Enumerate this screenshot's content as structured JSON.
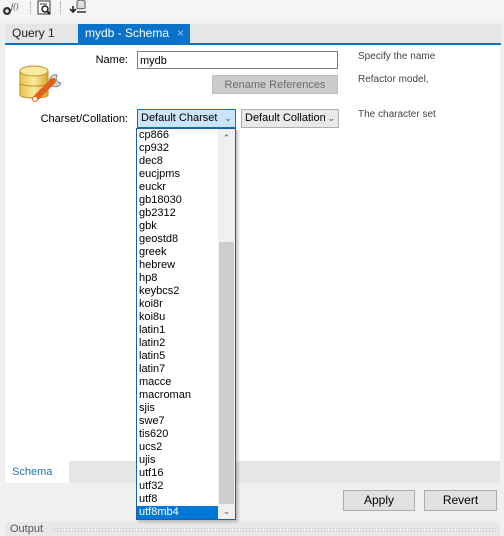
{
  "toolbar": {
    "icons": [
      {
        "name": "add-function-icon",
        "glyph": "ƒ"
      },
      {
        "name": "inspect-icon",
        "glyph": "🔍"
      },
      {
        "name": "reconnect-db-icon",
        "glyph": "⇅"
      }
    ]
  },
  "tabs": [
    {
      "label": "Query 1",
      "active": false
    },
    {
      "label": "mydb - Schema",
      "active": true,
      "close_glyph": "×"
    }
  ],
  "form": {
    "name_label": "Name:",
    "name_value": "mydb",
    "rename_button": "Rename References",
    "charset_label": "Charset/Collation:",
    "charset_value": "Default Charset",
    "collation_value": "Default Collation",
    "help_name": "Specify the name",
    "help_refactor": "Refactor model,",
    "help_charset": "The character set"
  },
  "charset_dropdown": {
    "items": [
      "cp866",
      "cp932",
      "dec8",
      "eucjpms",
      "euckr",
      "gb18030",
      "gb2312",
      "gbk",
      "geostd8",
      "greek",
      "hebrew",
      "hp8",
      "keybcs2",
      "koi8r",
      "koi8u",
      "latin1",
      "latin2",
      "latin5",
      "latin7",
      "macce",
      "macroman",
      "sjis",
      "swe7",
      "tis620",
      "ucs2",
      "ujis",
      "utf16",
      "utf32",
      "utf8",
      "utf8mb4"
    ],
    "selected": "utf8mb4",
    "scroll_up_glyph": "^",
    "scroll_down_glyph": "v"
  },
  "bottom_tabs": [
    {
      "label": "Schema"
    }
  ],
  "actions": {
    "apply": "Apply",
    "revert": "Revert"
  },
  "output": {
    "label": "Output"
  },
  "colors": {
    "accent": "#0b72c9",
    "selection": "#0078d7"
  }
}
